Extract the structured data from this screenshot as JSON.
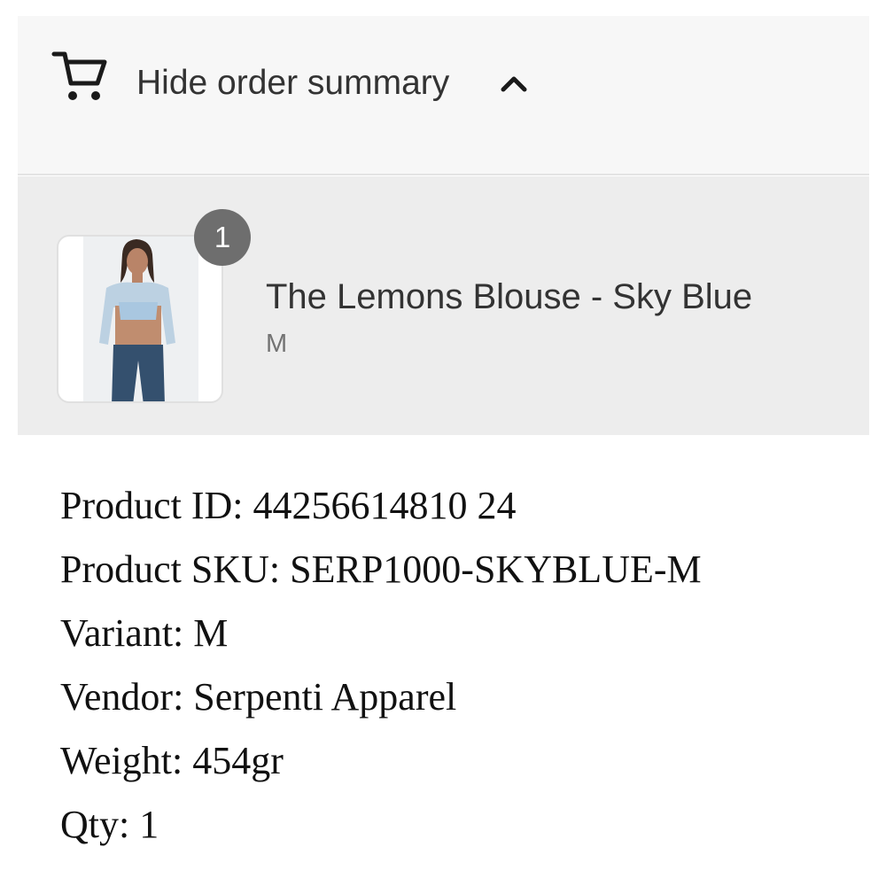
{
  "order_summary_toggle": {
    "label": "Hide order summary",
    "cart_icon": "cart-icon",
    "chevron_icon": "chevron-up-icon"
  },
  "line_item": {
    "quantity_badge": "1",
    "name": "The Lemons Blouse - Sky Blue",
    "variant": "M",
    "image": "product-thumbnail"
  },
  "details": {
    "product_id": "Product ID: 44256614810 24",
    "product_sku": "Product SKU: SERP1000-SKYBLUE-M",
    "variant": "Variant: M",
    "vendor": "Vendor: Serpenti Apparel",
    "weight": "Weight: 454gr",
    "qty": "Qty: 1"
  },
  "colors": {
    "toggle_bg": "#f7f7f7",
    "panel_bg": "#ededed",
    "badge_bg": "#6e6e6e",
    "text_primary": "#333333",
    "text_secondary": "#737373"
  }
}
